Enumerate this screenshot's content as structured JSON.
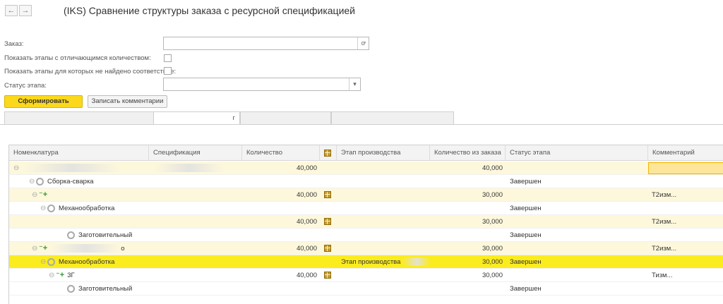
{
  "window": {
    "back_label": "←",
    "forward_label": "→",
    "title": "(IKS) Сравнение структуры заказа с ресурсной спецификацией"
  },
  "form": {
    "order_label": "Заказ:",
    "order_value": "",
    "order_select_icon": "ꝍ",
    "show_diff_label": "Показать этапы с отличающимся количеством:",
    "show_nomatch_label": "Показать этапы для которых не найдено соответствие:",
    "stage_status_label": "Статус этапа:",
    "stage_status_value": "",
    "dropdown_icon": "▾",
    "generate_button": "Сформировать",
    "save_comments_button": "Записать комментарии"
  },
  "tabs": [
    {
      "label": ""
    },
    {
      "label": "г"
    },
    {
      "label": ""
    },
    {
      "label": ""
    }
  ],
  "table": {
    "columns": [
      "Номенклатура",
      "Спецификация",
      "Количество",
      "",
      "Этап производства",
      "Количество из заказа",
      "Статус этапа",
      "Комментарий"
    ],
    "rows": [
      {
        "name": "",
        "spec": "",
        "qty": "40,000",
        "stage": "",
        "order_qty": "40,000",
        "status": "",
        "comment": ""
      },
      {
        "name": "Сборка-сварка",
        "spec": "",
        "qty": "",
        "stage": "",
        "order_qty": "",
        "status": "Завершен",
        "comment": ""
      },
      {
        "name": "",
        "spec": "",
        "qty": "40,000",
        "stage": "",
        "order_qty": "30,000",
        "status": "",
        "comment": "Т2изм..."
      },
      {
        "name": "Механообработка",
        "spec": "",
        "qty": "",
        "stage": "",
        "order_qty": "",
        "status": "Завершен",
        "comment": ""
      },
      {
        "name": "",
        "spec": "",
        "qty": "40,000",
        "stage": "",
        "order_qty": "30,000",
        "status": "",
        "comment": "Т2изм..."
      },
      {
        "name": "Заготовительный",
        "spec": "",
        "qty": "",
        "stage": "",
        "order_qty": "",
        "status": "Завершен",
        "comment": ""
      },
      {
        "name": "о",
        "spec": "",
        "qty": "40,000",
        "stage": "",
        "order_qty": "30,000",
        "status": "",
        "comment": "Т2изм..."
      },
      {
        "name": "Механообработка",
        "spec": "",
        "qty": "",
        "stage": "Этап производства",
        "order_qty": "30,000",
        "status": "Завершен",
        "comment": ""
      },
      {
        "name": "3Г",
        "spec": "",
        "qty": "40,000",
        "stage": "",
        "order_qty": "30,000",
        "status": "",
        "comment": "Тизм..."
      },
      {
        "name": "Заготовительный",
        "spec": "",
        "qty": "",
        "stage": "",
        "order_qty": "",
        "status": "Завершен",
        "comment": ""
      }
    ]
  },
  "colors": {
    "accent": "#fcd81d",
    "selected_row": "#fbec1f",
    "highlight_row": "#fdf8dc"
  }
}
